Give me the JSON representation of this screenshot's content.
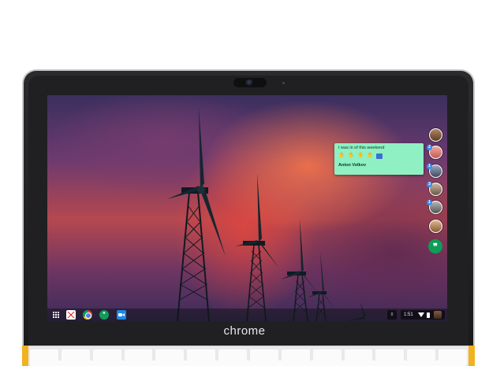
{
  "device": {
    "brand_label": "chrome"
  },
  "notification": {
    "message": "I was in of this weekend",
    "emojis": [
      "hand-emoji",
      "hand-emoji",
      "hand-emoji",
      "hand-emoji",
      "photo-emoji"
    ],
    "author": "Anton Volkov"
  },
  "contacts": {
    "badges": [
      "2",
      "1",
      "3",
      "1"
    ]
  },
  "shelf": {
    "apps": [
      "launcher-icon",
      "gmail-icon",
      "chrome-icon",
      "hangouts-icon",
      "video-call-icon"
    ],
    "notification_count": "0",
    "time": "1:51"
  },
  "colors": {
    "notification_bg": "#8ff0c3",
    "hangouts_green": "#0f9d58",
    "badge_blue": "#3b8df1",
    "trim_yellow": "#f0b21f"
  }
}
